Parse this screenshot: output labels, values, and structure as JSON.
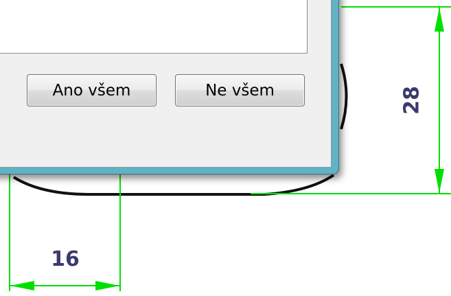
{
  "dialog": {
    "buttons": {
      "yes_all": "Ano všem",
      "no_all": "Ne všem"
    }
  },
  "dimensions": {
    "vertical": "28",
    "horizontal": "16"
  },
  "colors": {
    "dimension_line": "#00e000",
    "dimension_text": "#3a3a6e",
    "window_frame": "#5fb3c5"
  }
}
